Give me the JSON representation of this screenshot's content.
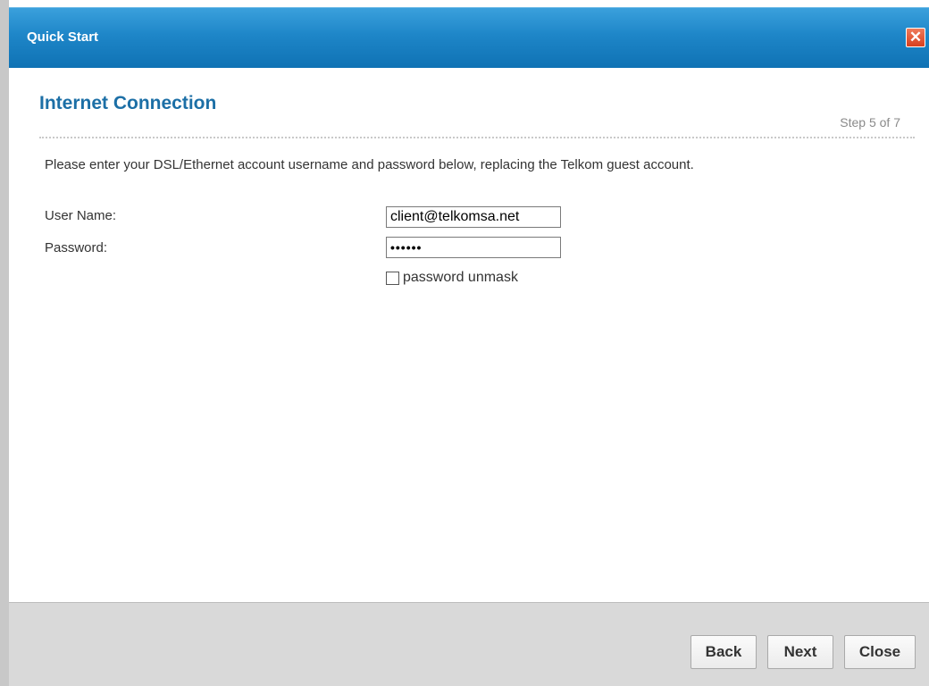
{
  "window": {
    "title": "Quick Start",
    "close_icon": "close-icon"
  },
  "page": {
    "heading": "Internet Connection",
    "step": "Step 5 of 7",
    "description": "Please enter your DSL/Ethernet account username and password below, replacing the Telkom guest account."
  },
  "form": {
    "username_label": "User Name:",
    "username_value": "client@telkomsa.net",
    "password_label": "Password:",
    "password_masked": "••••••",
    "unmask_label": "password unmask",
    "unmask_checked": false
  },
  "footer": {
    "back_label": "Back",
    "next_label": "Next",
    "close_label": "Close"
  },
  "colors": {
    "titlebar": "#1e86c8",
    "heading": "#1c6fa6",
    "close_button": "#d8401e",
    "footer": "#d9d9d9"
  }
}
